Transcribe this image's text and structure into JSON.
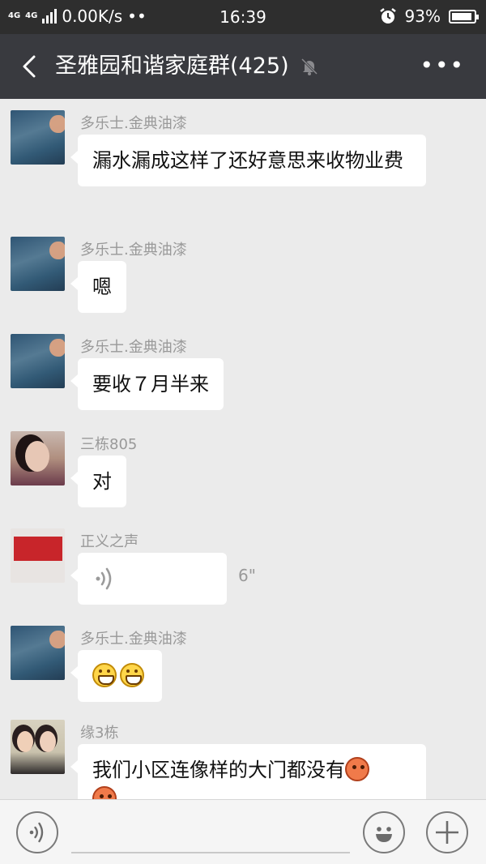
{
  "status_bar": {
    "network_tags": [
      "4G",
      "4G"
    ],
    "speed": "0.00K/s",
    "dots": "••",
    "time": "16:39",
    "battery_percent": "93%",
    "battery_level": 0.93,
    "icons": [
      "signal-icon",
      "alarm-clock-icon",
      "battery-icon"
    ]
  },
  "header": {
    "title": "圣雅园和谐家庭群(425)",
    "icons": [
      "back-arrow-icon",
      "mute-bell-icon",
      "more-icon"
    ],
    "more": "•••"
  },
  "messages": [
    {
      "sender": "多乐士.金典油漆",
      "text": "漏水漏成这样了还好意思来收物业费",
      "avatar": "sea-avatar"
    },
    {
      "sender": "多乐士.金典油漆",
      "text": "嗯",
      "avatar": "sea-avatar"
    },
    {
      "sender": "多乐士.金典油漆",
      "text": "要收７月半来",
      "avatar": "sea-avatar"
    },
    {
      "sender": "三栋805",
      "text": "对",
      "avatar": "woman-avatar"
    },
    {
      "sender": "正义之声",
      "voice_duration": "6\"",
      "avatar": "banner-avatar"
    },
    {
      "sender": "多乐士.金典油漆",
      "emoji": [
        "grin-emoji",
        "grin-emoji"
      ],
      "avatar": "sea-avatar"
    },
    {
      "sender": "缘3栋",
      "text": "我们小区连像样的大门都没有",
      "emoji": [
        "flushed-emoji",
        "flushed-emoji"
      ],
      "avatar": "duo-avatar"
    }
  ],
  "input_bar": {
    "icons": [
      "voice-input-icon",
      "emoji-icon",
      "plus-icon"
    ]
  },
  "colors": {
    "status_bar": "#2e2e2e",
    "title_bar": "#393a3f",
    "chat_background": "#ebebeb",
    "bubble": "#ffffff",
    "sender_name": "#999999"
  }
}
